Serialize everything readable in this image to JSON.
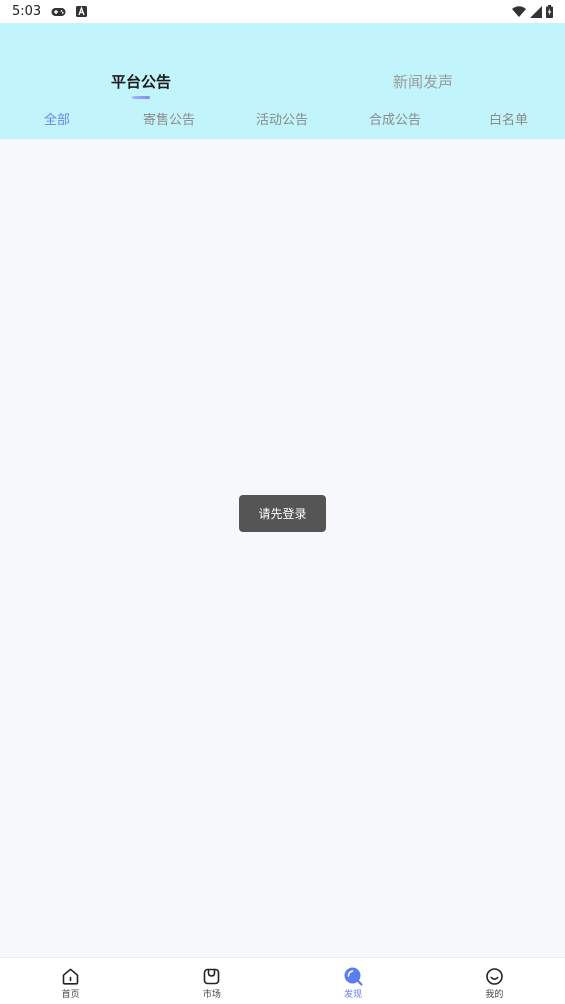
{
  "status_bar": {
    "time": "5:03",
    "left_icons": [
      "gamepad-icon",
      "a-box-icon"
    ],
    "right_icons": [
      "wifi-icon",
      "signal-icon",
      "battery-charging-icon"
    ]
  },
  "header": {
    "main_tabs": [
      {
        "label": "平台公告",
        "active": true
      },
      {
        "label": "新闻发声",
        "active": false
      }
    ],
    "sub_tabs": [
      {
        "label": "全部",
        "active": true
      },
      {
        "label": "寄售公告",
        "active": false
      },
      {
        "label": "活动公告",
        "active": false
      },
      {
        "label": "合成公告",
        "active": false
      },
      {
        "label": "白名单",
        "active": false
      }
    ]
  },
  "toast": {
    "message": "请先登录"
  },
  "bottom_nav": {
    "items": [
      {
        "label": "首页",
        "icon": "home-icon",
        "active": false
      },
      {
        "label": "市场",
        "icon": "shopping-bag-icon",
        "active": false
      },
      {
        "label": "发现",
        "icon": "discover-icon",
        "active": true
      },
      {
        "label": "我的",
        "icon": "smile-icon",
        "active": false
      }
    ]
  },
  "colors": {
    "header_bg": "#c2f4fc",
    "accent": "#6a86f2",
    "page_bg": "#f6f8fc",
    "toast_bg": "#555555"
  }
}
